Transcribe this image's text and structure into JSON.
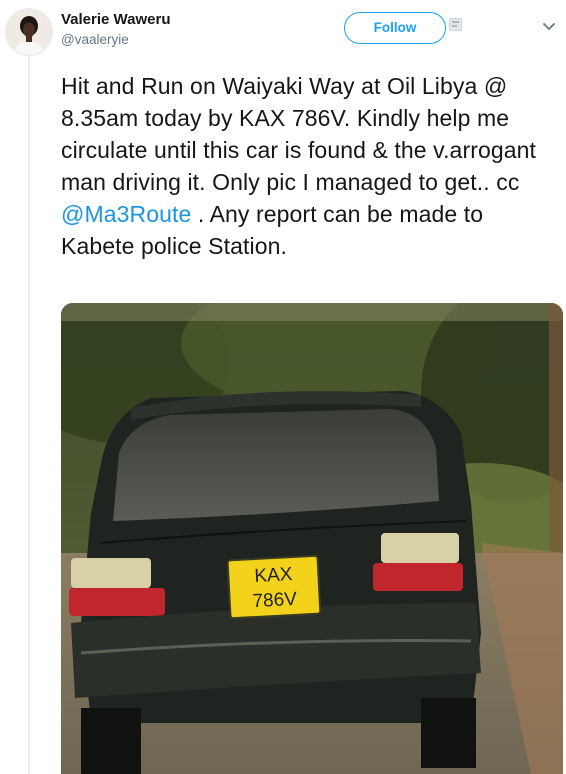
{
  "author": {
    "display_name": "Valerie Waweru",
    "handle": "@vaaleryie"
  },
  "follow_button": {
    "label": "Follow"
  },
  "tweet": {
    "text_before_mention": "Hit and Run on Waiyaki Way at Oil Libya @ 8.35am today by KAX 786V. Kindly help me circulate until this car is found & the v.arrogant man driving it. Only pic I managed to get.. cc ",
    "mention": "@Ma3Route",
    "text_after_mention": " . Any report can be made to Kabete police Station."
  },
  "photo": {
    "plate_line1": "KAX",
    "plate_line2": "786V"
  },
  "icons": {
    "options": "chevron-down-icon",
    "badge": "small-badge-icon"
  },
  "colors": {
    "accent": "#1da1f2",
    "mention": "#1b95e0",
    "secondary_text": "#657786",
    "plate": "#f2d21a"
  }
}
